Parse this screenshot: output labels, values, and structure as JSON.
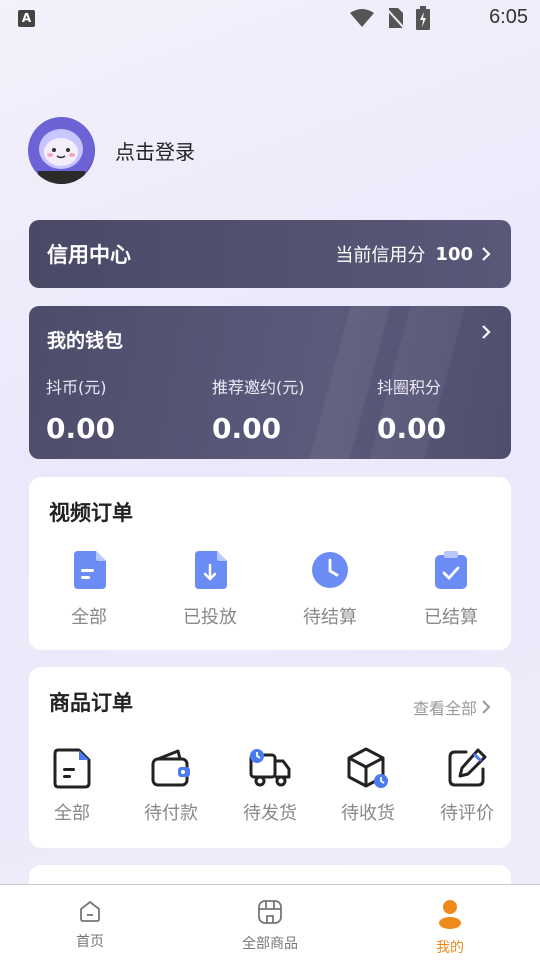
{
  "status_bar": {
    "time": "6:05",
    "left_icon": "A"
  },
  "profile": {
    "login_text": "点击登录"
  },
  "credit": {
    "title": "信用中心",
    "label": "当前信用分",
    "score": "100"
  },
  "wallet": {
    "title": "我的钱包",
    "items": [
      {
        "label": "抖币(元)",
        "value": "0.00"
      },
      {
        "label": "推荐邀约(元)",
        "value": "0.00"
      },
      {
        "label": "抖圈积分",
        "value": "0.00"
      }
    ]
  },
  "video_orders": {
    "title": "视频订单",
    "items": [
      {
        "label": "全部",
        "icon": "document-icon"
      },
      {
        "label": "已投放",
        "icon": "download-document-icon"
      },
      {
        "label": "待结算",
        "icon": "clock-icon"
      },
      {
        "label": "已结算",
        "icon": "clipboard-check-icon"
      }
    ]
  },
  "goods_orders": {
    "title": "商品订单",
    "view_all": "查看全部",
    "items": [
      {
        "label": "全部",
        "icon": "document-icon"
      },
      {
        "label": "待付款",
        "icon": "wallet-icon"
      },
      {
        "label": "待发货",
        "icon": "truck-icon"
      },
      {
        "label": "待收货",
        "icon": "package-icon"
      },
      {
        "label": "待评价",
        "icon": "edit-icon"
      }
    ]
  },
  "tabbar": {
    "items": [
      {
        "label": "首页",
        "icon": "home-icon"
      },
      {
        "label": "全部商品",
        "icon": "store-icon"
      },
      {
        "label": "我的",
        "icon": "user-icon"
      }
    ],
    "active_index": 2,
    "active_color": "#ee8a1b"
  }
}
